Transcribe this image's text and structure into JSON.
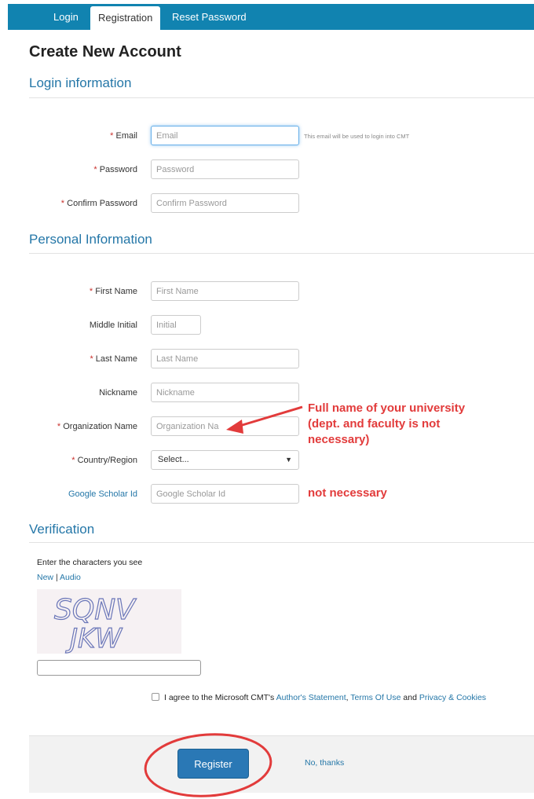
{
  "nav": {
    "tabs": [
      {
        "label": "Login"
      },
      {
        "label": "Registration"
      },
      {
        "label": "Reset Password"
      }
    ]
  },
  "page_title": "Create New Account",
  "sections": {
    "login": "Login information",
    "personal": "Personal Information",
    "verification": "Verification"
  },
  "fields": {
    "email": {
      "label": "Email",
      "placeholder": "Email",
      "hint": "This email will be used to login into CMT"
    },
    "password": {
      "label": "Password",
      "placeholder": "Password"
    },
    "confirm_password": {
      "label": "Confirm Password",
      "placeholder": "Confirm Password"
    },
    "first_name": {
      "label": "First Name",
      "placeholder": "First Name"
    },
    "middle_initial": {
      "label": "Middle Initial",
      "placeholder": "Initial"
    },
    "last_name": {
      "label": "Last Name",
      "placeholder": "Last Name"
    },
    "nickname": {
      "label": "Nickname",
      "placeholder": "Nickname"
    },
    "organization": {
      "label": "Organization Name",
      "placeholder": "Organization Na"
    },
    "country": {
      "label": "Country/Region",
      "value": "Select..."
    },
    "google_scholar": {
      "label": "Google Scholar Id",
      "placeholder": "Google Scholar Id"
    }
  },
  "required_mark": "*",
  "annotations": {
    "organization_note_line1": "Full name of your university",
    "organization_note_line2": "(dept. and faculty is not",
    "organization_note_line3": "necessary)",
    "scholar_note": "not necessary"
  },
  "verification": {
    "prompt": "Enter the characters you see",
    "new_link": "New",
    "separator": "|",
    "audio_link": "Audio",
    "captcha_text_line1": "SQNV",
    "captcha_text_line2": "JKW"
  },
  "agreement": {
    "prefix": "I agree to the Microsoft CMT's",
    "authors_statement": "Author's Statement",
    "comma": ",",
    "terms": "Terms Of Use",
    "and": "and",
    "privacy": "Privacy & Cookies"
  },
  "actions": {
    "register": "Register",
    "no_thanks": "No, thanks"
  },
  "colors": {
    "nav_bg": "#1183b0",
    "link": "#2577a8",
    "required": "#c9302c",
    "annotation": "#e23b3b",
    "register_btn": "#2a78b5"
  }
}
